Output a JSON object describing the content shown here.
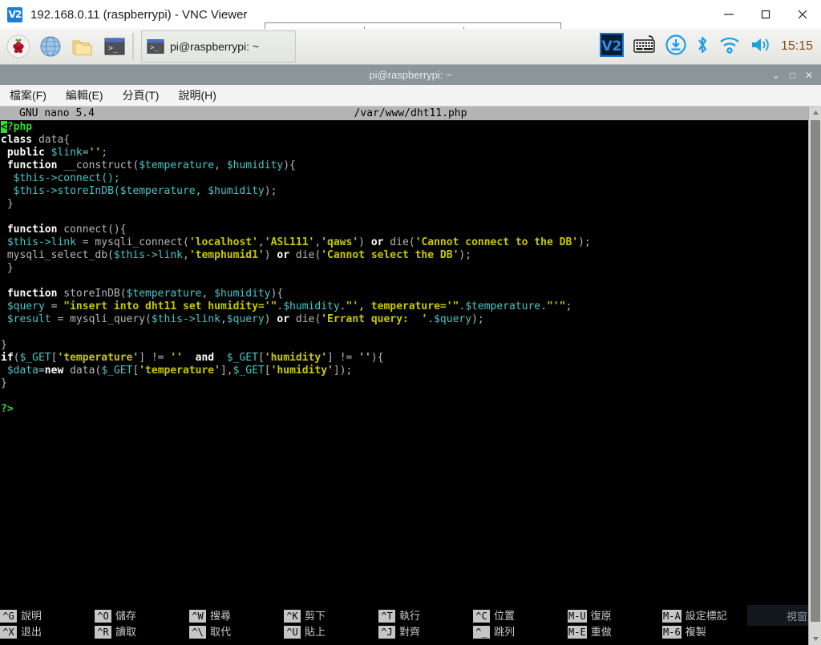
{
  "vnc": {
    "logo_text": "V2",
    "title": "192.168.0.11 (raspberrypi) - VNC Viewer",
    "minimize_label": "Minimize",
    "maximize_label": "Maximize",
    "close_label": "Close"
  },
  "taskbar": {
    "launchers": [
      {
        "name": "raspberry-menu-icon",
        "label": "Menu"
      },
      {
        "name": "web-browser-icon",
        "label": "Web Browser"
      },
      {
        "name": "file-manager-icon",
        "label": "File Manager"
      },
      {
        "name": "terminal-icon",
        "label": "Terminal"
      }
    ],
    "window_button": {
      "label": "pi@raspberrypi: ~"
    },
    "tray": [
      {
        "name": "vnc-server-icon",
        "label": "VNC Server"
      },
      {
        "name": "keyboard-icon",
        "label": "Keyboard"
      },
      {
        "name": "update-icon",
        "label": "Updates Available"
      },
      {
        "name": "bluetooth-icon",
        "label": "Bluetooth"
      },
      {
        "name": "wifi-icon",
        "label": "Wireless Network"
      },
      {
        "name": "volume-icon",
        "label": "Volume"
      }
    ],
    "clock": "15:15"
  },
  "terminal": {
    "title": "pi@raspberrypi: ~",
    "minimize_label": "⌄",
    "maximize_label": "□",
    "close_label": "✕",
    "menus": [
      {
        "label": "檔案(F)"
      },
      {
        "label": "編輯(E)"
      },
      {
        "label": "分頁(T)"
      },
      {
        "label": "說明(H)"
      }
    ]
  },
  "nano": {
    "version": "GNU nano 5.4",
    "filename": "/var/www/dht11.php",
    "tooltip": "視窗對",
    "lines": [
      [
        {
          "t": "<",
          "c": "cursor"
        },
        {
          "t": "?php",
          "c": "tag"
        }
      ],
      [
        {
          "t": "class",
          "c": "kw"
        },
        {
          "t": " data{",
          "c": "plain"
        }
      ],
      [
        {
          "t": " ",
          "c": "plain"
        },
        {
          "t": "public",
          "c": "kw"
        },
        {
          "t": " ",
          "c": "plain"
        },
        {
          "t": "$link",
          "c": "var"
        },
        {
          "t": "=",
          "c": "plain"
        },
        {
          "t": "''",
          "c": "str"
        },
        {
          "t": ";",
          "c": "plain"
        }
      ],
      [
        {
          "t": " ",
          "c": "plain"
        },
        {
          "t": "function",
          "c": "kw"
        },
        {
          "t": " __construct(",
          "c": "plain"
        },
        {
          "t": "$temperature",
          "c": "var"
        },
        {
          "t": ", ",
          "c": "plain"
        },
        {
          "t": "$humidity",
          "c": "var"
        },
        {
          "t": "){",
          "c": "plain"
        }
      ],
      [
        {
          "t": "  ",
          "c": "plain"
        },
        {
          "t": "$this",
          "c": "var"
        },
        {
          "t": "->connect();",
          "c": "var"
        }
      ],
      [
        {
          "t": "  ",
          "c": "plain"
        },
        {
          "t": "$this",
          "c": "var"
        },
        {
          "t": "->storeInDB(",
          "c": "var"
        },
        {
          "t": "$temperature",
          "c": "var"
        },
        {
          "t": ", ",
          "c": "plain"
        },
        {
          "t": "$humidity",
          "c": "var"
        },
        {
          "t": ");",
          "c": "plain"
        }
      ],
      [
        {
          "t": " }",
          "c": "plain"
        }
      ],
      [
        {
          "t": "",
          "c": "plain"
        }
      ],
      [
        {
          "t": " ",
          "c": "plain"
        },
        {
          "t": "function",
          "c": "kw"
        },
        {
          "t": " connect(){",
          "c": "plain"
        }
      ],
      [
        {
          "t": " ",
          "c": "plain"
        },
        {
          "t": "$this",
          "c": "var"
        },
        {
          "t": "->link",
          "c": "var"
        },
        {
          "t": " = mysqli_connect(",
          "c": "plain"
        },
        {
          "t": "'localhost'",
          "c": "str"
        },
        {
          "t": ",",
          "c": "plain"
        },
        {
          "t": "'ASL111'",
          "c": "str"
        },
        {
          "t": ",",
          "c": "plain"
        },
        {
          "t": "'qaws'",
          "c": "str"
        },
        {
          "t": ") ",
          "c": "plain"
        },
        {
          "t": "or",
          "c": "kw"
        },
        {
          "t": " die(",
          "c": "plain"
        },
        {
          "t": "'Cannot connect to the DB'",
          "c": "str"
        },
        {
          "t": ");",
          "c": "plain"
        }
      ],
      [
        {
          "t": " mysqli_select_db(",
          "c": "plain"
        },
        {
          "t": "$this",
          "c": "var"
        },
        {
          "t": "->link",
          "c": "var"
        },
        {
          "t": ",",
          "c": "plain"
        },
        {
          "t": "'temphumid1'",
          "c": "str"
        },
        {
          "t": ") ",
          "c": "plain"
        },
        {
          "t": "or",
          "c": "kw"
        },
        {
          "t": " die(",
          "c": "plain"
        },
        {
          "t": "'Cannot select the DB'",
          "c": "str"
        },
        {
          "t": ");",
          "c": "plain"
        }
      ],
      [
        {
          "t": " }",
          "c": "plain"
        }
      ],
      [
        {
          "t": "",
          "c": "plain"
        }
      ],
      [
        {
          "t": " ",
          "c": "plain"
        },
        {
          "t": "function",
          "c": "kw"
        },
        {
          "t": " storeInDB(",
          "c": "plain"
        },
        {
          "t": "$temperature",
          "c": "var"
        },
        {
          "t": ", ",
          "c": "plain"
        },
        {
          "t": "$humidity",
          "c": "var"
        },
        {
          "t": "){",
          "c": "plain"
        }
      ],
      [
        {
          "t": " ",
          "c": "plain"
        },
        {
          "t": "$query",
          "c": "var"
        },
        {
          "t": " = ",
          "c": "plain"
        },
        {
          "t": "\"insert into dht11 set humidity='\"",
          "c": "str"
        },
        {
          "t": ".",
          "c": "plain"
        },
        {
          "t": "$humidity",
          "c": "var"
        },
        {
          "t": ".",
          "c": "plain"
        },
        {
          "t": "\"', temperature='\"",
          "c": "str"
        },
        {
          "t": ".",
          "c": "plain"
        },
        {
          "t": "$temperature",
          "c": "var"
        },
        {
          "t": ".",
          "c": "plain"
        },
        {
          "t": "\"'\"",
          "c": "str"
        },
        {
          "t": ";",
          "c": "plain"
        }
      ],
      [
        {
          "t": " ",
          "c": "plain"
        },
        {
          "t": "$result",
          "c": "var"
        },
        {
          "t": " = mysqli_query(",
          "c": "plain"
        },
        {
          "t": "$this",
          "c": "var"
        },
        {
          "t": "->link",
          "c": "var"
        },
        {
          "t": ",",
          "c": "plain"
        },
        {
          "t": "$query",
          "c": "var"
        },
        {
          "t": ") ",
          "c": "plain"
        },
        {
          "t": "or",
          "c": "kw"
        },
        {
          "t": " die(",
          "c": "plain"
        },
        {
          "t": "'Errant query:  '",
          "c": "str"
        },
        {
          "t": ".",
          "c": "plain"
        },
        {
          "t": "$query",
          "c": "var"
        },
        {
          "t": ");",
          "c": "plain"
        }
      ],
      [
        {
          "t": "",
          "c": "plain"
        }
      ],
      [
        {
          "t": "}",
          "c": "plain"
        }
      ],
      [
        {
          "t": "if",
          "c": "kw"
        },
        {
          "t": "(",
          "c": "plain"
        },
        {
          "t": "$_GET",
          "c": "var"
        },
        {
          "t": "[",
          "c": "plain"
        },
        {
          "t": "'temperature'",
          "c": "str"
        },
        {
          "t": "] != ",
          "c": "plain"
        },
        {
          "t": "''",
          "c": "str"
        },
        {
          "t": "  ",
          "c": "plain"
        },
        {
          "t": "and",
          "c": "kw"
        },
        {
          "t": "  ",
          "c": "plain"
        },
        {
          "t": "$_GET",
          "c": "var"
        },
        {
          "t": "[",
          "c": "plain"
        },
        {
          "t": "'humidity'",
          "c": "str"
        },
        {
          "t": "] != ",
          "c": "plain"
        },
        {
          "t": "''",
          "c": "str"
        },
        {
          "t": "){",
          "c": "plain"
        }
      ],
      [
        {
          "t": " ",
          "c": "plain"
        },
        {
          "t": "$data",
          "c": "var"
        },
        {
          "t": "=",
          "c": "plain"
        },
        {
          "t": "new",
          "c": "kw"
        },
        {
          "t": " data(",
          "c": "plain"
        },
        {
          "t": "$_GET",
          "c": "var"
        },
        {
          "t": "[",
          "c": "plain"
        },
        {
          "t": "'temperature'",
          "c": "str"
        },
        {
          "t": "],",
          "c": "plain"
        },
        {
          "t": "$_GET",
          "c": "var"
        },
        {
          "t": "[",
          "c": "plain"
        },
        {
          "t": "'humidity'",
          "c": "str"
        },
        {
          "t": "]);",
          "c": "plain"
        }
      ],
      [
        {
          "t": "}",
          "c": "plain"
        }
      ],
      [
        {
          "t": "",
          "c": "plain"
        }
      ],
      [
        {
          "t": "?>",
          "c": "tag"
        }
      ]
    ],
    "shortcuts": [
      {
        "key1": "^G",
        "label1": "說明",
        "key2": "^X",
        "label2": "退出"
      },
      {
        "key1": "^O",
        "label1": "儲存",
        "key2": "^R",
        "label2": "讀取"
      },
      {
        "key1": "^W",
        "label1": "搜尋",
        "key2": "^\\",
        "label2": "取代"
      },
      {
        "key1": "^K",
        "label1": "剪下",
        "key2": "^U",
        "label2": "貼上"
      },
      {
        "key1": "^T",
        "label1": "執行",
        "key2": "^J",
        "label2": "對齊"
      },
      {
        "key1": "^C",
        "label1": "位置",
        "key2": "^_",
        "label2": "跳列"
      },
      {
        "key1": "M-U",
        "label1": "復原",
        "key2": "M-E",
        "label2": "重做"
      },
      {
        "key1": "M-A",
        "label1": "設定標記",
        "key2": "M-6",
        "label2": "複製"
      }
    ]
  },
  "colors": {
    "keyword": "#ffffff",
    "variable": "#46c7c7",
    "string": "#c8c800",
    "php_tag": "#2fdd2f",
    "plain_text": "#b7b7b7",
    "terminal_bg": "#000000",
    "nano_header_bg": "#b4b4b4",
    "term_titlebar_bg": "#8a9699",
    "clock_color": "#8a4a17"
  }
}
